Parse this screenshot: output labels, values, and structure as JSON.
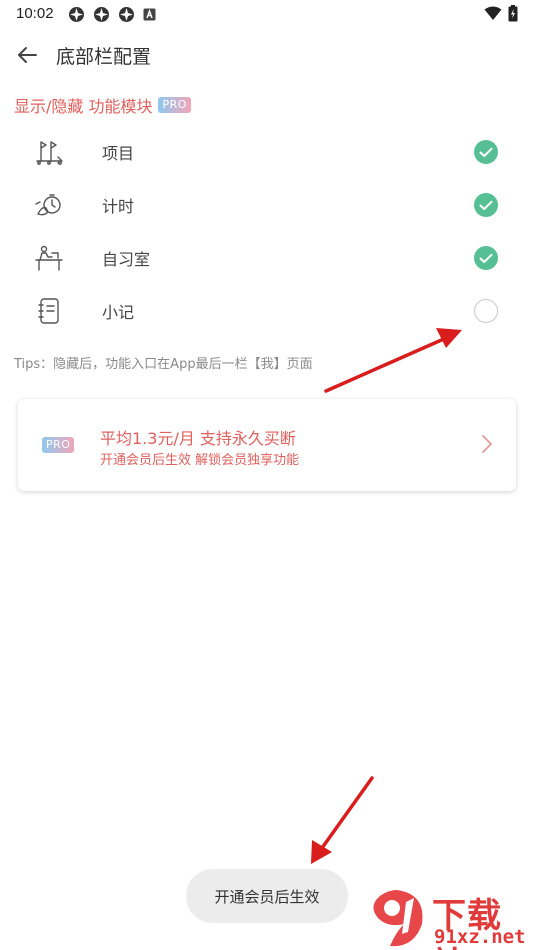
{
  "status_bar": {
    "time": "10:02",
    "notification_icons": [
      "app-icon",
      "app-icon",
      "app-icon",
      "a-icon"
    ],
    "system_icons": [
      "wifi-icon",
      "battery-charging-icon"
    ]
  },
  "app_bar": {
    "title": "底部栏配置",
    "back_icon": "back-arrow-icon"
  },
  "section": {
    "title": "显示/隐藏 功能模块",
    "badge": "PRO"
  },
  "items": [
    {
      "label": "项目",
      "icon": "project-icon",
      "enabled": true
    },
    {
      "label": "计时",
      "icon": "timer-icon",
      "enabled": true
    },
    {
      "label": "自习室",
      "icon": "study-room-icon",
      "enabled": true
    },
    {
      "label": "小记",
      "icon": "notebook-icon",
      "enabled": false
    }
  ],
  "tips": "Tips：隐藏后，功能入口在App最后一栏【我】页面",
  "pro_card": {
    "badge": "PRO",
    "title": "平均1.3元/月 支持永久买断",
    "subtitle": "开通会员后生效 解锁会员独享功能"
  },
  "toast": "开通会员后生效",
  "watermark": {
    "title": "下载站",
    "site": "91xz.net"
  },
  "colors": {
    "accent_red": "#e0605e",
    "toggle_green": "#57bf94",
    "annotation_arrow": "#d91c1c"
  }
}
